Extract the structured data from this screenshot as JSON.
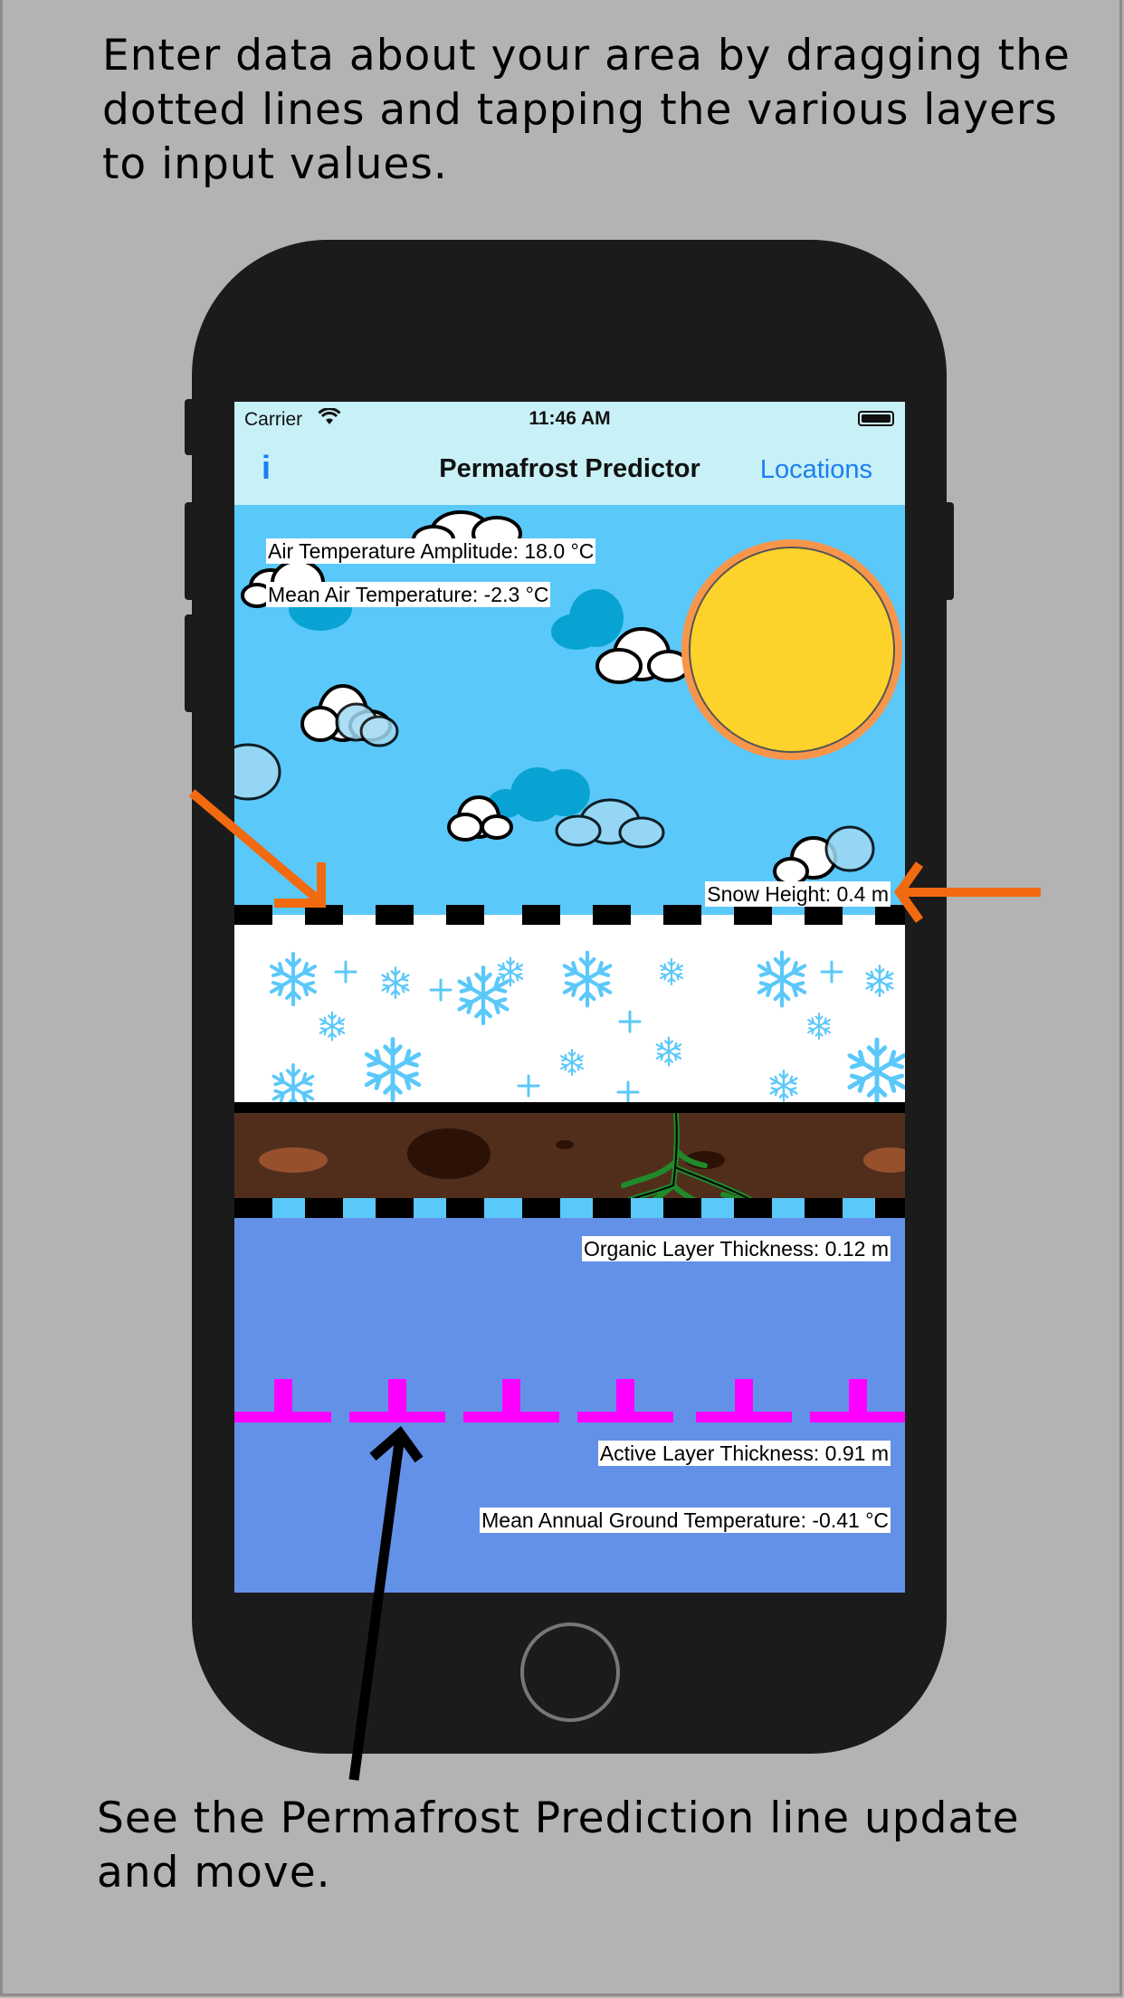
{
  "captions": {
    "top": "Enter data about your area by dragging the dotted lines and tapping the various layers to input values.",
    "bottom": "See the Permafrost Prediction line update and move."
  },
  "status_bar": {
    "carrier": "Carrier",
    "time": "11:46 AM"
  },
  "nav": {
    "info_label": "i",
    "title": "Permafrost Predictor",
    "locations_label": "Locations"
  },
  "labels": {
    "air_temp_amplitude": "Air Temperature Amplitude: 18.0 °C",
    "mean_air_temp": "Mean Air Temperature: -2.3 °C",
    "snow_height": "Snow Height: 0.4 m",
    "organic_layer": "Organic Layer Thickness: 0.12 m",
    "active_layer": "Active Layer Thickness: 0.91 m",
    "mean_ground_temp": "Mean Annual Ground Temperature: -0.41 °C"
  },
  "colors": {
    "page_bg": "#b3b3b3",
    "sky": "#5bc8fa",
    "sun": "#fdd22b",
    "sun_ring": "#f7964a",
    "soil": "#512e1c",
    "ground": "#6491e8",
    "permafrost_line": "#ff00ff",
    "arrow_orange": "#f26a10",
    "ios_blue": "#1a7ef0"
  },
  "icons": [
    "wifi-icon",
    "battery-icon",
    "sun-icon",
    "cloud-icon",
    "snowflake-icon",
    "roots-icon",
    "home-button-icon"
  ]
}
